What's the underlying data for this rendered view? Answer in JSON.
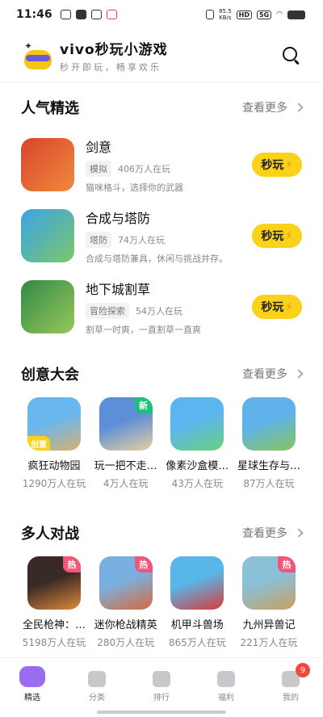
{
  "status_bar": {
    "time": "11:46",
    "net_speed_top": "85.5",
    "net_speed_unit": "KB/s",
    "hd": "HD",
    "signal": "5G"
  },
  "header": {
    "title": "vivo秒玩小游戏",
    "subtitle": "秒开即玩，畅享欢乐"
  },
  "sections": {
    "popular": {
      "title": "人气精选",
      "more": "查看更多",
      "games": [
        {
          "name": "剑意",
          "tag": "模拟",
          "players": "406万人在玩",
          "desc": "猫咪格斗，选择你的武器",
          "play": "秒玩",
          "colors": [
            "#d9442c",
            "#f08a3c"
          ]
        },
        {
          "name": "合成与塔防",
          "tag": "塔防",
          "players": "74万人在玩",
          "desc": "合成与塔防兼具，休闲与挑战并存。",
          "play": "秒玩",
          "colors": [
            "#3aa3e8",
            "#7cc86a"
          ]
        },
        {
          "name": "地下城割草",
          "tag": "冒险探索",
          "players": "54万人在玩",
          "desc": "割草一时爽，一直割草一直爽",
          "play": "秒玩",
          "colors": [
            "#2f8a46",
            "#9ac75a"
          ]
        }
      ]
    },
    "creative": {
      "title": "创意大会",
      "more": "查看更多",
      "tiles": [
        {
          "name": "疯狂动物园",
          "players": "1290万人在玩",
          "badge_bl": "创意",
          "colors": [
            "#6ab7ef",
            "#d8b070"
          ]
        },
        {
          "name": "玩一把不走…",
          "players": "4万人在玩",
          "badge": "新",
          "colors": [
            "#5d8fd8",
            "#e8d0a0"
          ]
        },
        {
          "name": "像素沙盒模…",
          "players": "43万人在玩",
          "colors": [
            "#5bb6f0",
            "#6bd07a"
          ]
        },
        {
          "name": "星球生存与…",
          "players": "87万人在玩",
          "colors": [
            "#5fb2ea",
            "#88c65a"
          ]
        }
      ]
    },
    "multiplayer": {
      "title": "多人对战",
      "more": "查看更多",
      "tiles": [
        {
          "name": "全民枪神：…",
          "players": "5198万人在玩",
          "badge": "热",
          "colors": [
            "#3a2a26",
            "#e08a3a"
          ]
        },
        {
          "name": "迷你枪战精英",
          "players": "280万人在玩",
          "badge": "热",
          "colors": [
            "#7ab0e0",
            "#d86a3a"
          ]
        },
        {
          "name": "机甲斗兽场",
          "players": "865万人在玩",
          "colors": [
            "#58b6e8",
            "#d83a3a"
          ]
        },
        {
          "name": "九州异兽记",
          "players": "221万人在玩",
          "badge": "热",
          "colors": [
            "#8ac0d8",
            "#c8a060"
          ]
        }
      ]
    }
  },
  "bottom_nav": [
    {
      "label": "精选",
      "active": true
    },
    {
      "label": "分类"
    },
    {
      "label": "排行"
    },
    {
      "label": "福利"
    },
    {
      "label": "我的",
      "badge": "9"
    }
  ]
}
